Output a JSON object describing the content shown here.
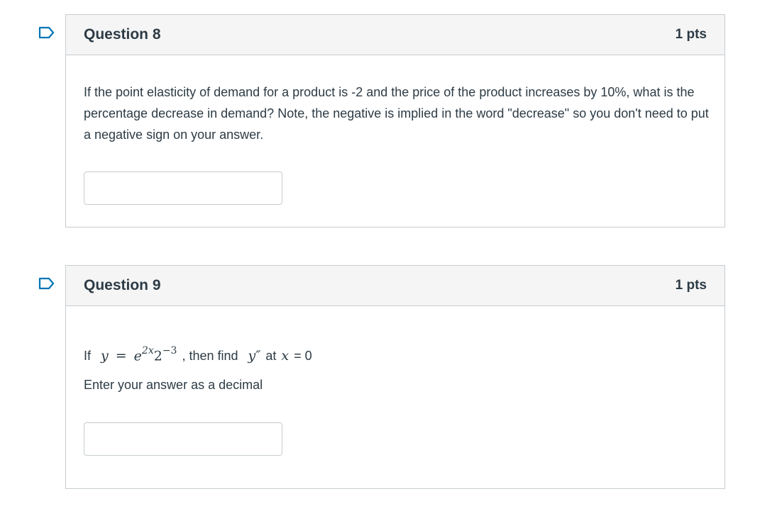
{
  "questions": [
    {
      "title": "Question 8",
      "points": "1 pts",
      "text": "If the point elasticity of demand for a product is -2 and the price of the product increases by 10%, what is the percentage decrease in demand?  Note, the negative is implied in the word \"decrease\" so you don't need to put a negative sign on your answer.",
      "answer_value": ""
    },
    {
      "title": "Question 9",
      "points": "1 pts",
      "prefix": "If",
      "var_y": "y",
      "equals": "=",
      "base_e": "e",
      "exp_e": "2x",
      "base_2": "2",
      "exp_2": "−3",
      "mid": ", then find",
      "y_double_prime": "y″",
      "at_word": "at",
      "var_x": "x",
      "suffix": "= 0",
      "instruction": "Enter your answer as a decimal",
      "answer_value": ""
    }
  ],
  "colors": {
    "header_bg": "#f5f5f5",
    "border": "#c7cdd1",
    "text": "#2d3b45",
    "flag": "#0374b5"
  },
  "icons": {
    "flag": "bookmark-flag-icon"
  }
}
